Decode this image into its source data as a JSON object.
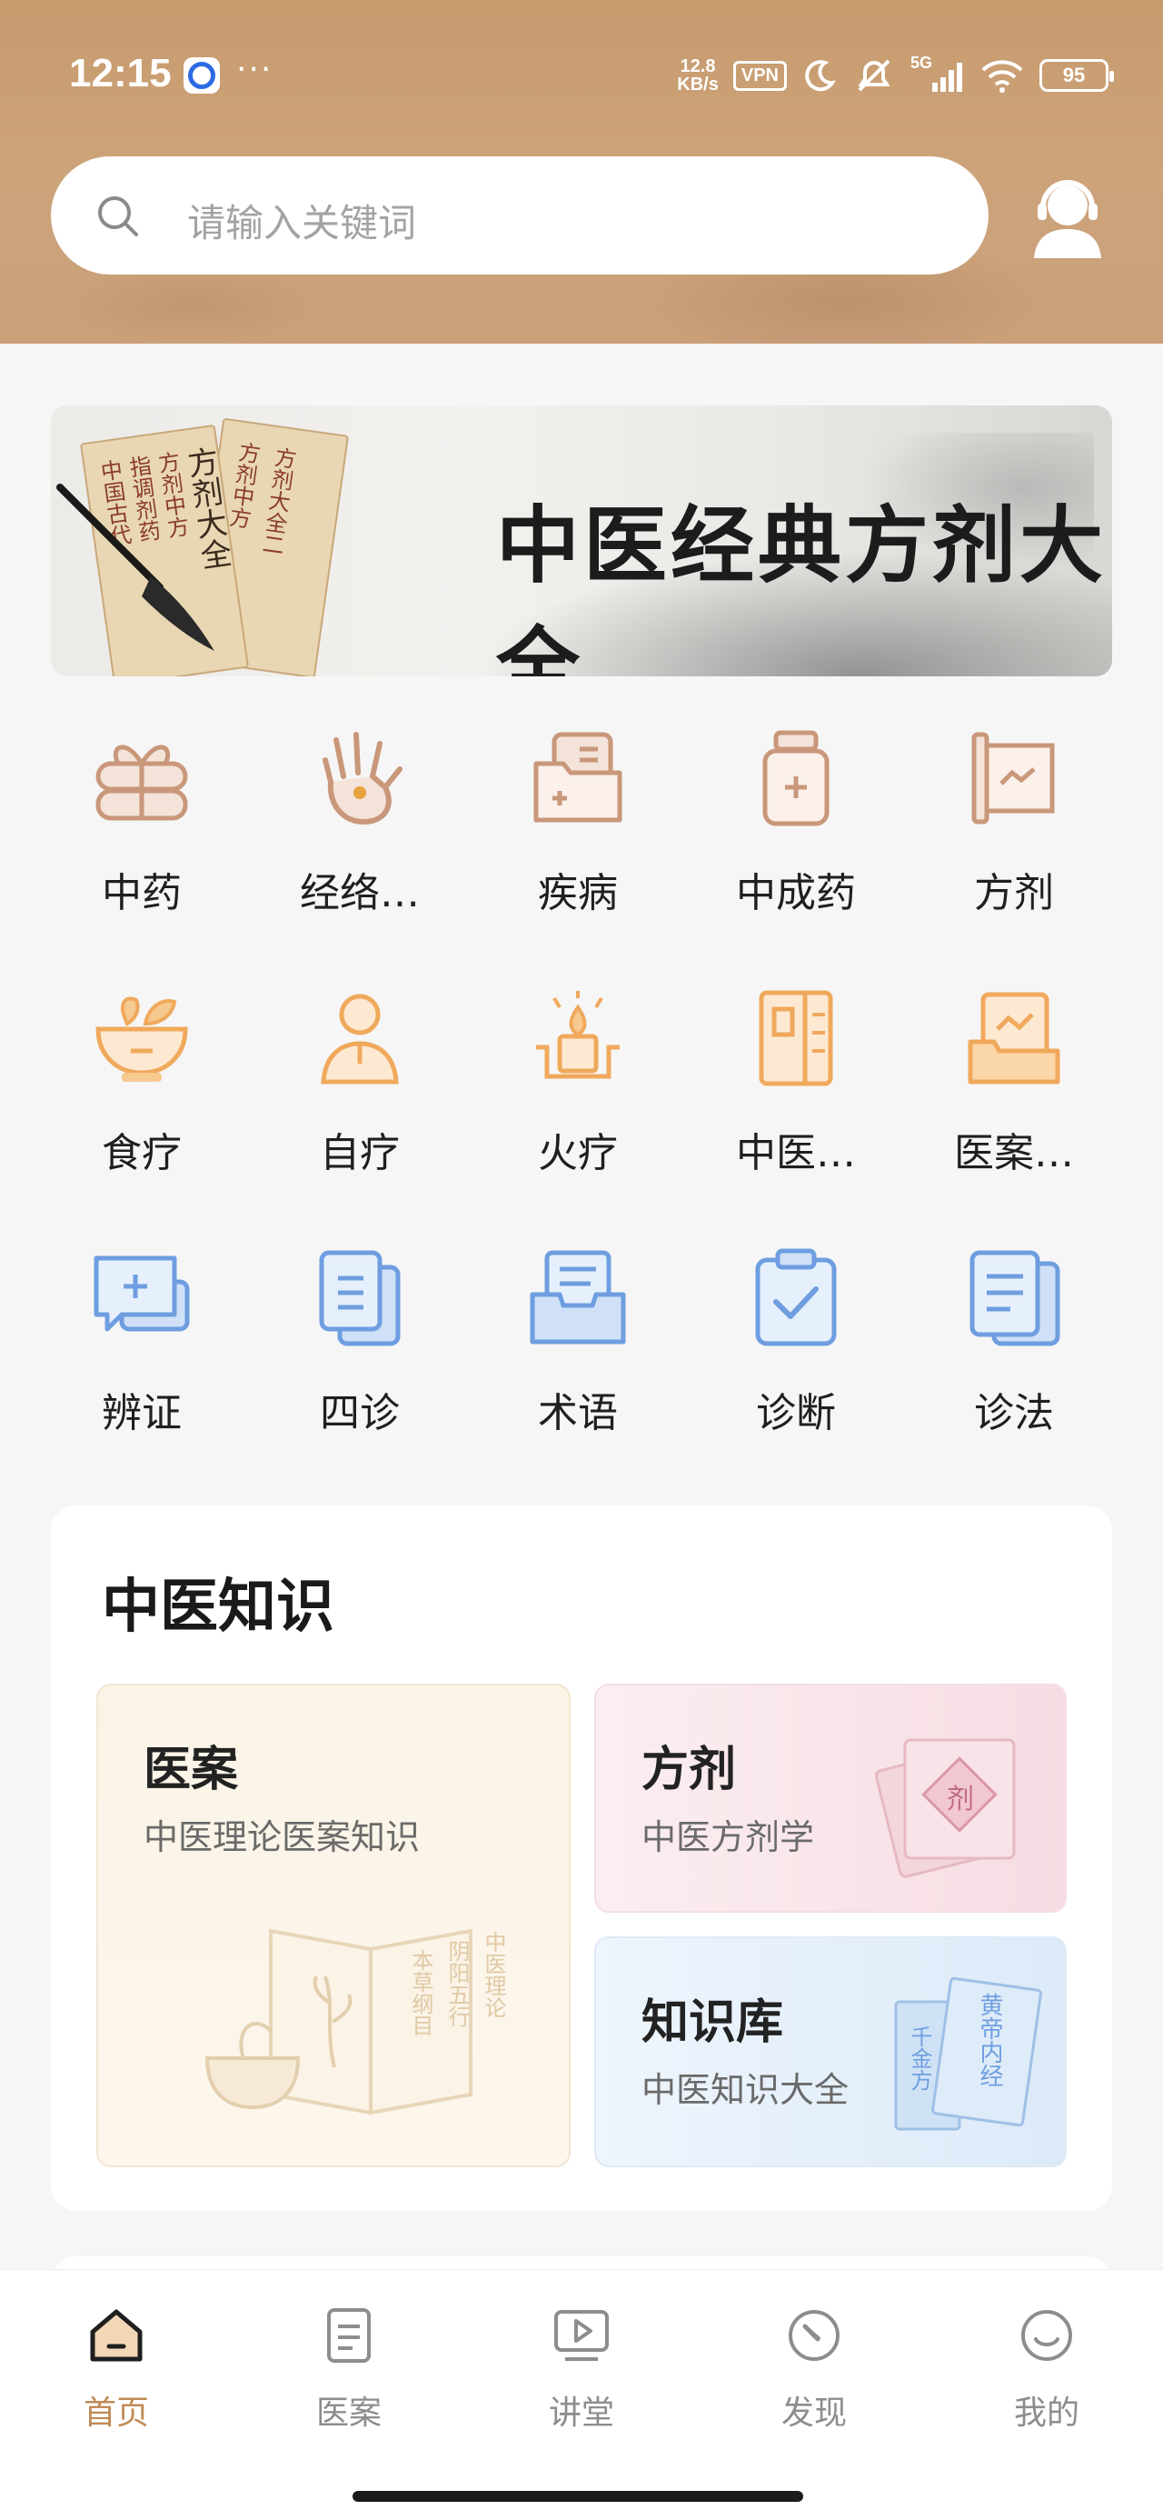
{
  "status_bar": {
    "time": "12:15",
    "more": "···",
    "net_speed_value": "12.8",
    "net_speed_unit": "KB/s",
    "vpn": "VPN",
    "signal": "5G",
    "battery": "95"
  },
  "search": {
    "placeholder": "请输入关键词",
    "icon": "search-icon"
  },
  "profile_icon": "user-headset-icon",
  "banner": {
    "title": "中医经典方剂大全",
    "scroll_texts": [
      "中国古代",
      "指调剂药",
      "方剂中方",
      "方剂大全",
      "方剂中方",
      "方剂大全二"
    ]
  },
  "categories": [
    {
      "label": "中药",
      "icon": "herb-gift-icon",
      "color": "#c9977a"
    },
    {
      "label": "经络…",
      "icon": "hand-acupoint-icon",
      "color": "#c9977a"
    },
    {
      "label": "疾病",
      "icon": "medical-folder-icon",
      "color": "#c9977a"
    },
    {
      "label": "中成药",
      "icon": "medicine-jar-icon",
      "color": "#c9977a"
    },
    {
      "label": "方剂",
      "icon": "scroll-icon",
      "color": "#c9977a"
    },
    {
      "label": "食疗",
      "icon": "food-bowl-icon",
      "color": "#f0a95c"
    },
    {
      "label": "自疗",
      "icon": "person-icon",
      "color": "#f0a95c"
    },
    {
      "label": "火疗",
      "icon": "fire-candle-icon",
      "color": "#f0a95c"
    },
    {
      "label": "中医…",
      "icon": "book-icon",
      "color": "#f0a95c"
    },
    {
      "label": "医案…",
      "icon": "case-file-icon",
      "color": "#f0a95c"
    },
    {
      "label": "辨证",
      "icon": "chat-plus-icon",
      "color": "#6e9ee0"
    },
    {
      "label": "四诊",
      "icon": "documents-icon",
      "color": "#6e9ee0"
    },
    {
      "label": "术语",
      "icon": "inbox-tray-icon",
      "color": "#6e9ee0"
    },
    {
      "label": "诊断",
      "icon": "clipboard-check-icon",
      "color": "#6e9ee0"
    },
    {
      "label": "诊法",
      "icon": "document-lines-icon",
      "color": "#6e9ee0"
    }
  ],
  "knowledge": {
    "title": "中医知识",
    "tiles": [
      {
        "title": "医案",
        "subtitle": "中医理论医案知识",
        "art_text": [
          "本草纲目",
          "阴阳五行",
          "中医理论"
        ]
      },
      {
        "title": "方剂",
        "subtitle": "中医方剂学",
        "art_text": "剂"
      },
      {
        "title": "知识库",
        "subtitle": "中医知识大全",
        "art_text": [
          "千金方",
          "黄帝内经"
        ]
      }
    ]
  },
  "bottom_nav": [
    {
      "label": "首页",
      "icon": "home-icon",
      "active": true
    },
    {
      "label": "医案",
      "icon": "document-icon",
      "active": false
    },
    {
      "label": "讲堂",
      "icon": "video-play-icon",
      "active": false
    },
    {
      "label": "发现",
      "icon": "compass-icon",
      "active": false
    },
    {
      "label": "我的",
      "icon": "smiley-icon",
      "active": false
    }
  ],
  "colors": {
    "header_bg": "#c9a07a",
    "active_tab": "#c08a55",
    "brown_icons": "#c9977a",
    "orange_icons": "#f0a95c",
    "blue_icons": "#6e9ee0"
  }
}
